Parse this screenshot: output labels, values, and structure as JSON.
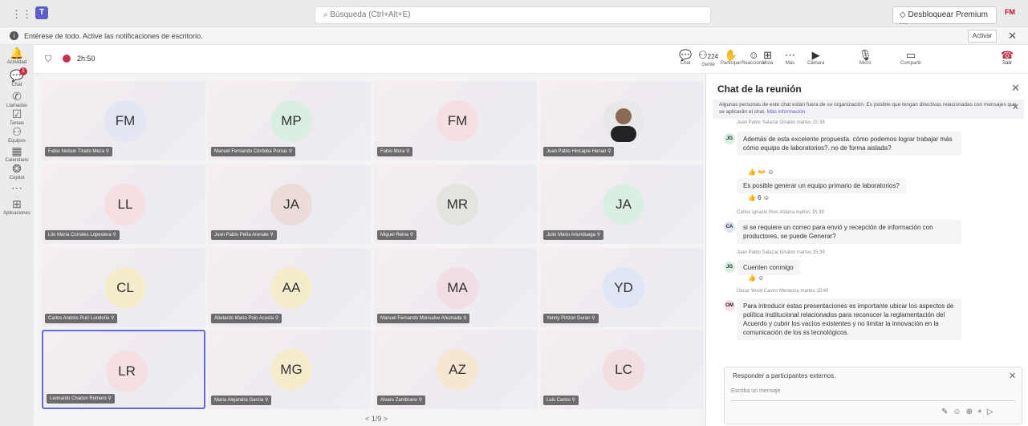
{
  "topbar": {
    "grid_icon": "apps-grid-icon",
    "search_placeholder": "Búsqueda (Ctrl+Alt+E)",
    "premium_label": "Desbloquear Premium",
    "premium_more": "···",
    "user_initials": "FM"
  },
  "notification": {
    "text": "Entérese de todo. Active las notificaciones de escritorio.",
    "action": "Activar"
  },
  "rail": [
    {
      "label": "Actividad",
      "icon": "bell-icon"
    },
    {
      "label": "Chat",
      "icon": "chat-icon",
      "badge": "1"
    },
    {
      "label": "Llamadas",
      "icon": "phone-icon"
    },
    {
      "label": "Tareas",
      "icon": "tasks-icon"
    },
    {
      "label": "Equipos",
      "icon": "teams-icon"
    },
    {
      "label": "Calendario",
      "icon": "calendar-icon"
    },
    {
      "label": "Copilot",
      "icon": "copilot-icon"
    },
    {
      "label": "···",
      "icon": "more-icon"
    },
    {
      "label": "Aplicaciones",
      "icon": "apps-icon"
    }
  ],
  "call": {
    "timer": "2h:50",
    "controls": [
      {
        "label": "Chat",
        "icon": "chat-icon"
      },
      {
        "label": "Gente",
        "icon": "people-icon",
        "count": "224"
      },
      {
        "label": "Participar",
        "icon": "raise-hand-icon"
      },
      {
        "label": "Reaccionar",
        "icon": "emoji-icon"
      },
      {
        "label": "Vista",
        "icon": "view-icon"
      },
      {
        "label": "Más",
        "icon": "more-icon"
      },
      {
        "label": "Cámara",
        "icon": "camera-icon"
      },
      {
        "label": "Micro",
        "icon": "mic-icon"
      },
      {
        "label": "Compartir",
        "icon": "share-icon"
      }
    ],
    "leave_label": "Salir"
  },
  "participants": [
    {
      "initials": "FM",
      "name": "Fabio Nelson Tirado Meza",
      "color": "#e3e6f3"
    },
    {
      "initials": "MP",
      "name": "Manuel Fernando Córdoba Porras",
      "color": "#d9efe1"
    },
    {
      "initials": "FM",
      "name": "Fabio Mora",
      "color": "#f6dfe2"
    },
    {
      "initials": "",
      "name": "Juan Pablo Hincapie Henao",
      "color": "#e8e8e8",
      "photo": true
    },
    {
      "initials": "LL",
      "name": "Lilo María Corrales Lopesiera",
      "color": "#f6dfe2"
    },
    {
      "initials": "JA",
      "name": "Juan Pablo Peña Arenale",
      "color": "#ecdcd8"
    },
    {
      "initials": "MR",
      "name": "Miguel Reina",
      "color": "#e2e4dd"
    },
    {
      "initials": "JA",
      "name": "Julio Mario Arlunduaga",
      "color": "#dbeee4"
    },
    {
      "initials": "CL",
      "name": "Carlos Andrés Ruiz Londoño",
      "color": "#f5ecce"
    },
    {
      "initials": "AA",
      "name": "Abelardo Mario Polo Acosta",
      "color": "#f5ecce"
    },
    {
      "initials": "MA",
      "name": "Manuel Fernando Monsalve Ahumada",
      "color": "#f2dde3"
    },
    {
      "initials": "YD",
      "name": "Yenny Pinzon Duran",
      "color": "#e0e5f4"
    },
    {
      "initials": "LR",
      "name": "Leonardo Chacon Romero",
      "color": "#f6dfe2"
    },
    {
      "initials": "MG",
      "name": "Maria Alejandra García",
      "color": "#f5ecce"
    },
    {
      "initials": "AZ",
      "name": "Alvaro Zambrano",
      "color": "#f5e7d2"
    },
    {
      "initials": "LC",
      "name": "Luis Carlos",
      "color": "#f2dde0"
    }
  ],
  "pager": "< 1/9 >",
  "chat": {
    "title": "Chat de la reunión",
    "banner_text": "Algunas personas de este chat están fuera de su organización. Es posible que tengan directivas relacionadas con mensajes que se aplicarán el chat.",
    "banner_link": "Más información",
    "messages": [
      {
        "meta": "Juan Pablo Salazar Giraldo  martes 15:38",
        "initials": "JG",
        "color": "#d7efe0",
        "text": "Además de esta excelente propuesta. cómo podemos lograr trabajar más cómo equipo de laboratorios?. no de forma aislada?",
        "reactions": "👍 👐 ☺"
      },
      {
        "meta": "",
        "initials": "",
        "color": "",
        "text": "Es posible generar un equipo primario de laboratorios?",
        "reactions": "👍 6 ☺"
      },
      {
        "meta": "Carlos Ignacio Rios Aldana  martes 15:39",
        "initials": "CA",
        "color": "#e0e5f4",
        "text": "si se requiere un correo para envió y recepción de información con productores, se puede Generar?",
        "reactions": ""
      },
      {
        "meta": "Juan Pablo Salazar Giraldo  martes 15:39",
        "initials": "JG",
        "color": "#d7efe0",
        "text": "Cuenten conmigo",
        "reactions": "👍 ☺"
      },
      {
        "meta": "Oscar Yesid Castro Mendoza  martes 15:40",
        "initials": "OM",
        "color": "#f6dfe2",
        "text": "Para introducir estas presentaciones es importante ubicar los aspectos de política institucional relacionados para reconocer la reglamentación del Acuerdo y cubrir los vacíos existentes y no limitar la innovación en la comunicación de los ss tecnológicos.",
        "reactions": ""
      }
    ],
    "reply_header": "Responder a participantes externos.",
    "reply_placeholder": "Escriba un mensaje"
  }
}
